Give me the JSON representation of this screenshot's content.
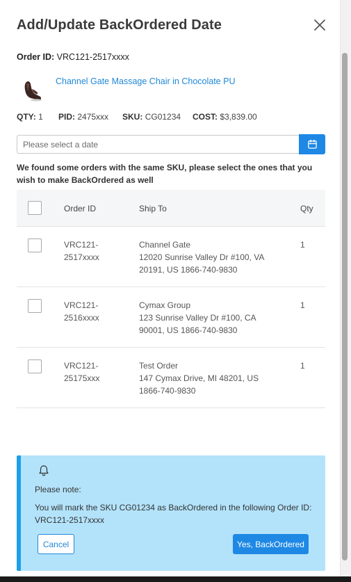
{
  "modal": {
    "title": "Add/Update BackOrdered Date",
    "close_icon": "close-icon"
  },
  "order": {
    "id_label": "Order ID:",
    "id_value": "VRC121-2517xxxx"
  },
  "product": {
    "name": "Channel Gate Massage Chair in Chocolate PU",
    "qty_label": "QTY:",
    "qty_value": "1",
    "pid_label": "PID:",
    "pid_value": "2475xxx",
    "sku_label": "SKU:",
    "sku_value": "CG01234",
    "cost_label": "COST:",
    "cost_value": "$3,839.00"
  },
  "date_picker": {
    "placeholder": "Please select a date",
    "icon": "calendar-icon"
  },
  "notice_text": "We found some orders with the same SKU, please select the ones that you wish to make BackOrdered as well",
  "table": {
    "headers": [
      "Order ID",
      "Ship To",
      "Qty"
    ],
    "rows": [
      {
        "order_id": "VRC121-\n2517xxxx",
        "ship_name": "Channel Gate",
        "ship_address": "12020 Sunrise Valley Dr #100, VA 20191, US 1866-740-9830",
        "qty": "1"
      },
      {
        "order_id": "VRC121-\n2516xxxx",
        "ship_name": "Cymax Group",
        "ship_address": "123 Sunrise Valley Dr #100, CA 90001, US 1866-740-9830",
        "qty": "1"
      },
      {
        "order_id": "VRC121-\n25175xxx",
        "ship_name": "Test Order",
        "ship_address": "147 Cymax Drive, MI 48201, US 1866-740-9830",
        "qty": "1"
      }
    ]
  },
  "alert": {
    "icon": "bell-icon",
    "title": "Please note:",
    "message": "You will mark the SKU CG01234 as BackOrdered in the following Order ID: VRC121-2517xxxx",
    "cancel_label": "Cancel",
    "confirm_label": "Yes, BackOrdered",
    "background_color": "#b3e3fa",
    "accent_color": "#1f9fe6"
  },
  "colors": {
    "primary": "#1e88e5",
    "link": "#1f88d9"
  }
}
